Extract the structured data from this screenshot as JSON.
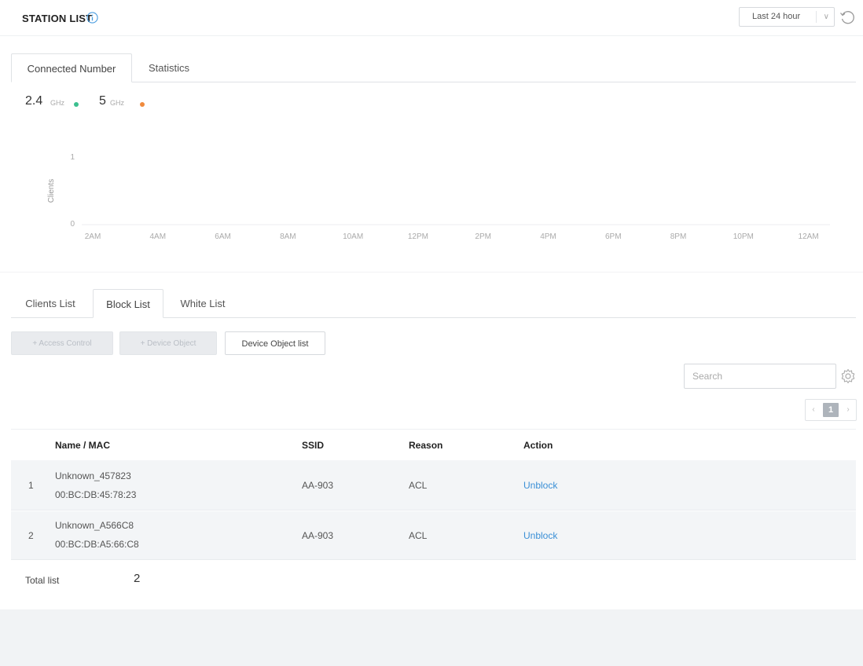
{
  "header": {
    "title": "STATION LIST",
    "time_range": "Last 24 hour"
  },
  "top_tabs": [
    "Connected Number",
    "Statistics"
  ],
  "legend": [
    {
      "value": "2.4",
      "unit": "GHz",
      "color": "#3cbf8f"
    },
    {
      "value": "5",
      "unit": "GHz",
      "color": "#f08a3c"
    }
  ],
  "chart_data": {
    "type": "line",
    "ylabel": "Clients",
    "y_ticks": [
      "1",
      "0"
    ],
    "ylim": [
      0,
      1
    ],
    "categories": [
      "2AM",
      "4AM",
      "6AM",
      "8AM",
      "10AM",
      "12PM",
      "2PM",
      "4PM",
      "6PM",
      "8PM",
      "10PM",
      "12AM"
    ],
    "series": [
      {
        "values": [
          0,
          0,
          0,
          0,
          0,
          0,
          0,
          0,
          0,
          0,
          0,
          0
        ],
        "color": "#3cbf8f"
      }
    ]
  },
  "bottom_tabs": [
    "Clients List",
    "Block List",
    "White List"
  ],
  "buttons": {
    "access_control": "+ Access Control",
    "device_object": "+ Device Object",
    "device_object_list": "Device Object list"
  },
  "search": {
    "placeholder": "Search"
  },
  "pager": {
    "prev": "‹",
    "current": "1",
    "next": "›"
  },
  "table": {
    "headers": [
      "Name / MAC",
      "SSID",
      "Reason",
      "Action"
    ],
    "rows": [
      {
        "index": "1",
        "name": "Unknown_457823",
        "mac": "00:BC:DB:45:78:23",
        "ssid": "AA-903",
        "reason": "ACL",
        "action": "Unblock"
      },
      {
        "index": "2",
        "name": "Unknown_A566C8",
        "mac": "00:BC:DB:A5:66:C8",
        "ssid": "AA-903",
        "reason": "ACL",
        "action": "Unblock"
      }
    ]
  },
  "total": {
    "label": "Total list",
    "value": "2"
  }
}
